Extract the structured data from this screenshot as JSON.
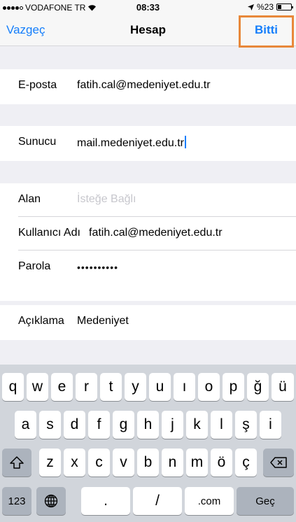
{
  "status_bar": {
    "carrier": "VODAFONE TR",
    "time": "08:33",
    "battery": "%23"
  },
  "nav": {
    "cancel_label": "Vazgeç",
    "title": "Hesap",
    "done_label": "Bitti"
  },
  "form": {
    "email": {
      "label": "E-posta",
      "value": "fatih.cal@medeniyet.edu.tr"
    },
    "server": {
      "label": "Sunucu",
      "value": "mail.medeniyet.edu.tr"
    },
    "domain": {
      "label": "Alan",
      "placeholder": "İsteğe Bağlı"
    },
    "username": {
      "label": "Kullanıcı Adı",
      "value": "fatih.cal@medeniyet.edu.tr"
    },
    "password": {
      "label": "Parola",
      "value": "••••••••••"
    },
    "description": {
      "label": "Açıklama",
      "value": "Medeniyet"
    }
  },
  "keyboard": {
    "row1": [
      "q",
      "w",
      "e",
      "r",
      "t",
      "y",
      "u",
      "ı",
      "o",
      "p",
      "ğ",
      "ü"
    ],
    "row2": [
      "a",
      "s",
      "d",
      "f",
      "g",
      "h",
      "j",
      "k",
      "l",
      "ş",
      "i"
    ],
    "row3": [
      "z",
      "x",
      "c",
      "v",
      "b",
      "n",
      "m",
      "ö",
      "ç"
    ],
    "numbers_label": "123",
    "dot_label": ".",
    "slash_label": "/",
    "com_label": ".com",
    "return_label": "Geç"
  },
  "icons": {
    "wifi": "wifi-icon",
    "location": "location-arrow-icon",
    "shift": "shift-icon",
    "delete": "backspace-icon",
    "globe": "globe-icon"
  },
  "colors": {
    "accent": "#157efb",
    "highlight_border": "#e8883a"
  }
}
